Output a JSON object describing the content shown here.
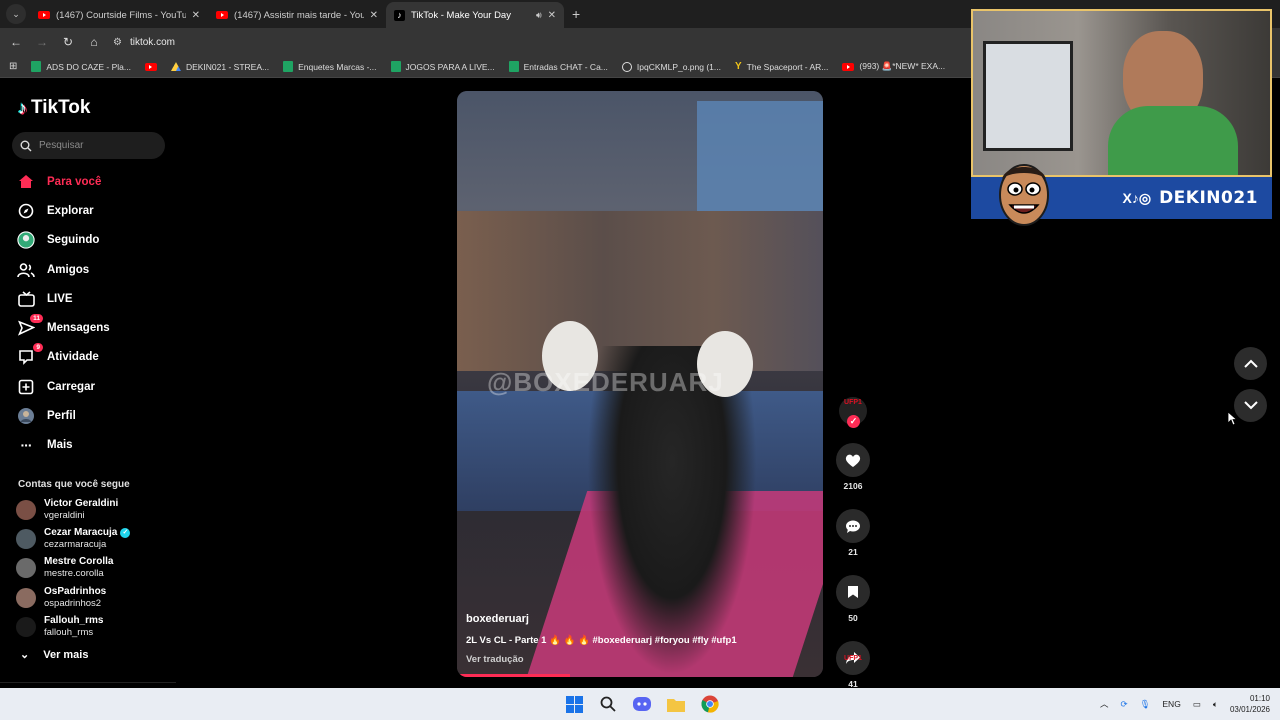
{
  "browser": {
    "tabs": [
      {
        "title": "(1467) Courtside Films - YouTub",
        "icon": "youtube-icon",
        "active": false
      },
      {
        "title": "(1467) Assistir mais tarde - You",
        "icon": "youtube-icon",
        "active": false
      },
      {
        "title": "TikTok - Make Your Day",
        "icon": "tiktok-icon",
        "active": true
      }
    ],
    "url": "tiktok.com",
    "bookmarks": [
      {
        "label": "ADS DO CAZE - Pla...",
        "icon": "sheets-icon"
      },
      {
        "label": "",
        "icon": "youtube-icon"
      },
      {
        "label": "DEKIN021 - STREA...",
        "icon": "drive-icon"
      },
      {
        "label": "Enquetes Marcas -...",
        "icon": "sheets-icon"
      },
      {
        "label": "JOGOS PARA A LIVE...",
        "icon": "sheets-icon"
      },
      {
        "label": "Entradas CHAT - Ca...",
        "icon": "sheets-icon"
      },
      {
        "label": "IpqCKMLP_o.png (1...",
        "icon": "github-icon"
      },
      {
        "label": "The Spaceport - AR...",
        "icon": "y-icon"
      },
      {
        "label": "(993) 🚨*NEW* EXA...",
        "icon": "youtube-icon"
      }
    ]
  },
  "tiktok": {
    "logo": "TikTok",
    "search_placeholder": "Pesquisar",
    "nav": [
      {
        "label": "Para você",
        "icon": "home-icon",
        "active": true,
        "badge": ""
      },
      {
        "label": "Explorar",
        "icon": "compass-icon",
        "active": false,
        "badge": ""
      },
      {
        "label": "Seguindo",
        "icon": "following-avatar-icon",
        "active": false,
        "badge": ""
      },
      {
        "label": "Amigos",
        "icon": "friends-icon",
        "active": false,
        "badge": ""
      },
      {
        "label": "LIVE",
        "icon": "live-icon",
        "active": false,
        "badge": ""
      },
      {
        "label": "Mensagens",
        "icon": "messages-icon",
        "active": false,
        "badge": "11"
      },
      {
        "label": "Atividade",
        "icon": "activity-icon",
        "active": false,
        "badge": "9"
      },
      {
        "label": "Carregar",
        "icon": "upload-icon",
        "active": false,
        "badge": ""
      },
      {
        "label": "Perfil",
        "icon": "profile-icon",
        "active": false,
        "badge": ""
      },
      {
        "label": "Mais",
        "icon": "more-icon",
        "active": false,
        "badge": ""
      }
    ],
    "following_title": "Contas que você segue",
    "following": [
      {
        "name": "Victor Geraldini",
        "user": "vgeraldini",
        "verified": false
      },
      {
        "name": "Cezar Maracuja",
        "user": "cezarmaracuja",
        "verified": true
      },
      {
        "name": "Mestre Corolla",
        "user": "mestre.corolla",
        "verified": false
      },
      {
        "name": "OsPadrinhos",
        "user": "ospadrinhos2",
        "verified": false
      },
      {
        "name": "Fallouh_rms",
        "user": "fallouh_rms",
        "verified": false
      }
    ],
    "see_more": "Ver mais",
    "video": {
      "author": "boxederuarj",
      "caption": "2L Vs CL - Parte 1 🔥 🔥 🔥 #boxederuarj #foryou #fly #ufp1",
      "translate": "Ver tradução",
      "watermark": "@BOXEDERUARJ",
      "progress": 0.31,
      "creator_badge": "UFP1"
    },
    "actions": {
      "likes": "2106",
      "comments": "21",
      "saves": "50",
      "shares": "41"
    }
  },
  "webcam": {
    "handle": "DEKIN021",
    "socials": "X♪◎"
  },
  "taskbar": {
    "language": "ENG",
    "time": "01:10",
    "date": "03/01/2026"
  },
  "colors": {
    "accent": "#fe2c55",
    "banner": "#1d4aa1",
    "cam_border": "#e9c46a"
  }
}
